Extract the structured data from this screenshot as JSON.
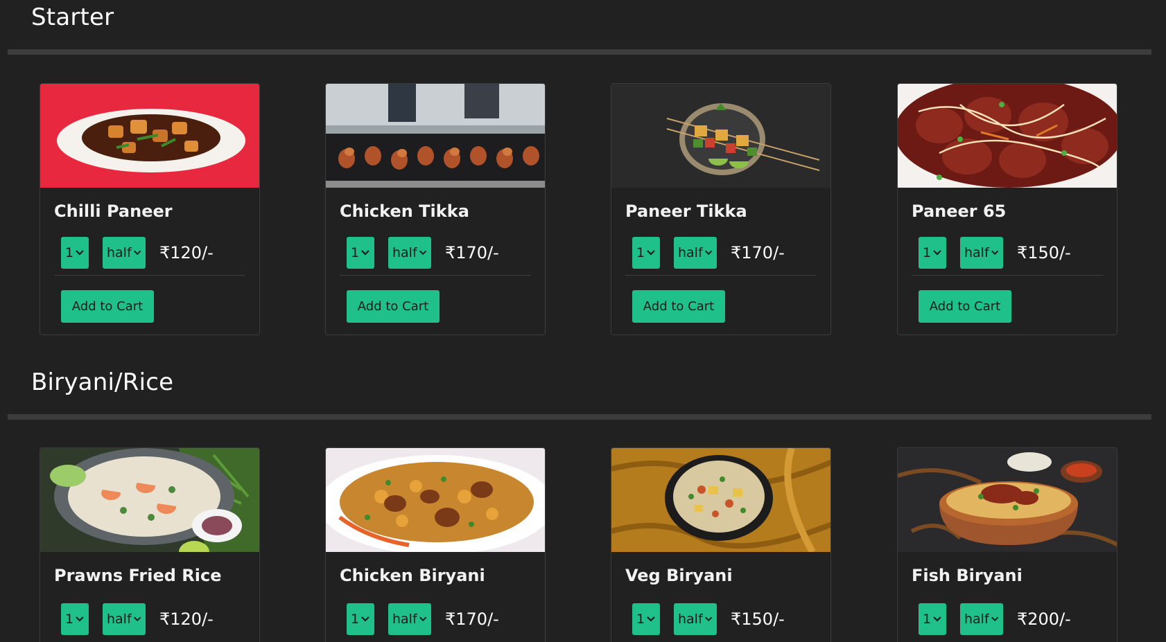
{
  "sections": [
    {
      "title": "Starter",
      "items": [
        {
          "name": "Chilli Paneer",
          "qty": "1",
          "size": "half",
          "price": "₹120/-",
          "button": "Add to Cart"
        },
        {
          "name": "Chicken Tikka",
          "qty": "1",
          "size": "half",
          "price": "₹170/-",
          "button": "Add to Cart"
        },
        {
          "name": "Paneer Tikka",
          "qty": "1",
          "size": "half",
          "price": "₹170/-",
          "button": "Add to Cart"
        },
        {
          "name": "Paneer 65",
          "qty": "1",
          "size": "half",
          "price": "₹150/-",
          "button": "Add to Cart"
        }
      ]
    },
    {
      "title": "Biryani/Rice",
      "items": [
        {
          "name": "Prawns Fried Rice",
          "qty": "1",
          "size": "half",
          "price": "₹120/-"
        },
        {
          "name": "Chicken Biryani",
          "qty": "1",
          "size": "half",
          "price": "₹170/-"
        },
        {
          "name": "Veg Biryani",
          "qty": "1",
          "size": "half",
          "price": "₹150/-"
        },
        {
          "name": "Fish Biryani",
          "qty": "1",
          "size": "half",
          "price": "₹200/-"
        }
      ]
    }
  ],
  "colors": {
    "background": "#212121",
    "accent": "#1fc08a",
    "divider": "#3c3c3c",
    "card_border": "#3b3b3b"
  }
}
